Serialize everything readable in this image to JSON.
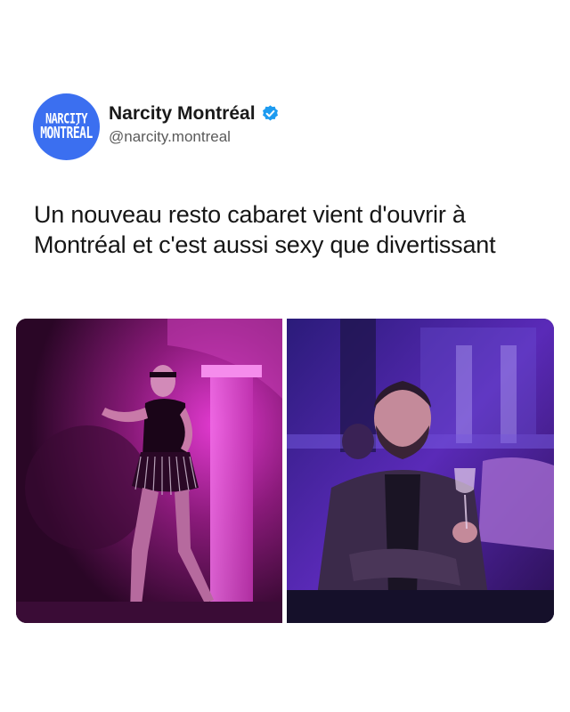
{
  "account": {
    "avatar_line1": "NARCITY",
    "avatar_line2": "MONTRÉAL",
    "display_name": "Narcity Montréal",
    "handle": "@narcity.montreal",
    "verified_icon": "verified-badge-icon",
    "avatar_color": "#3b6ff0",
    "verified_color": "#1d9bf0"
  },
  "post": {
    "text": "Un nouveau resto cabaret vient d'ouvrir à Montréal et c'est aussi sexy que divertissant"
  },
  "media": [
    {
      "kind": "photo",
      "subject": "performer-on-stage"
    },
    {
      "kind": "photo",
      "subject": "guest-with-wine-glass"
    }
  ]
}
